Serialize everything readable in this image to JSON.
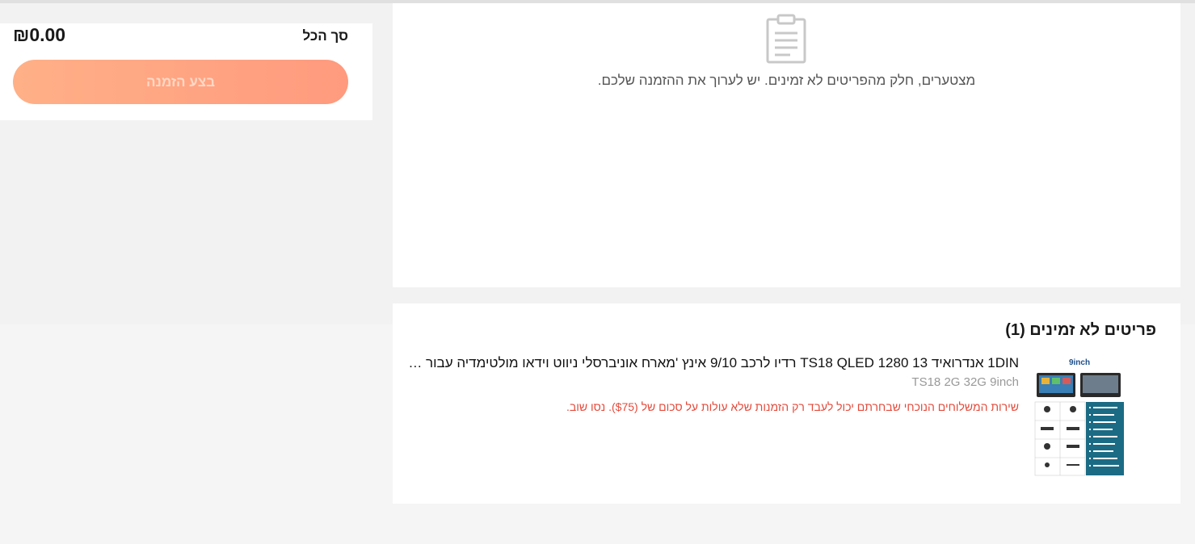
{
  "summary": {
    "total_label": "סך הכל",
    "total_value": "₪0.00",
    "place_order_label": "בצע הזמנה"
  },
  "notice": {
    "icon": "clipboard-icon",
    "message": "מצטערים, חלק מהפריטים לא זמינים. יש לערוך את ההזמנה שלכם."
  },
  "unavailable": {
    "title": "פריטים לא זמינים (1)",
    "items": [
      {
        "name": "1DIN אנדרואיד 13 TS18 QLED 1280 רדיו לרכב 9/10 אינץ 'מארח אוניברסלי ניווט וידאו מולטימדיה עבור ל...",
        "variant": "TS18 2G 32G 9inch",
        "error": "שירות המשלוחים הנוכחי שבחרתם יכול לעבד רק הזמנות שלא עולות על סכום של ($75). נסו שוב.",
        "thumb_caption": "9inch",
        "thumb_specs": [
          "Model TS18",
          "Size 9 inch",
          "RAM 2 GB",
          "ROM 32 GB",
          "Bluetooth 5.0",
          "Resolution 1280*720",
          "CPU 8 Core",
          "CarPlay Wireless",
          "Android Auto Wireless"
        ],
        "thumb_parts": [
          "Power cable",
          "GPS antenna",
          "RCA cable",
          "USB cable",
          "AV cable",
          "Frame",
          "MIC",
          "Remote"
        ]
      }
    ]
  },
  "colors": {
    "button_start": "#ffb087",
    "button_end": "#ff9a7e",
    "error": "#e5493a",
    "thumb_panel": "#1b6b85"
  }
}
